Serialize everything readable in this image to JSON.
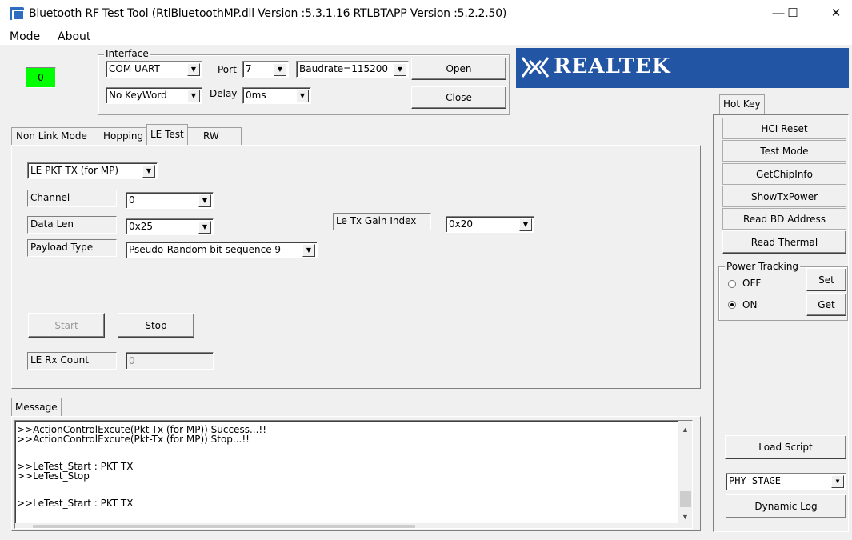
{
  "window": {
    "title": "Bluetooth RF Test Tool (RtlBluetoothMP.dll Version :5.3.1.16   RTLBTAPP Version :5.2.2.50)",
    "minimize": "—",
    "maximize": "☐",
    "close": "✕"
  },
  "menu": {
    "mode": "Mode",
    "about": "About"
  },
  "status_indicator": {
    "value": "0",
    "color": "#00ff00"
  },
  "interface": {
    "group_label": "Interface",
    "connection": "COM UART",
    "port_label": "Port",
    "port": "7",
    "baudrate": "Baudrate=115200",
    "keyword": "No KeyWord",
    "delay_label": "Delay",
    "delay": "0ms",
    "open": "Open",
    "close": "Close"
  },
  "logo": {
    "text": "REALTEK",
    "color": "#2255a4"
  },
  "tabs": {
    "non_link_mode": "Non Link Mode",
    "hopping": "Hopping",
    "le_test": "LE Test",
    "rw": "RW",
    "active": "LE Test"
  },
  "le_test": {
    "mode": "LE PKT TX (for MP)",
    "channel_label": "Channel",
    "channel": "0",
    "data_len_label": "Data Len",
    "data_len": "0x25",
    "payload_label": "Payload Type",
    "payload": "Pseudo-Random bit sequence 9",
    "gain_label": "Le Tx Gain Index",
    "gain": "0x20",
    "start": "Start",
    "stop": "Stop",
    "rx_count_label": "LE Rx Count",
    "rx_count": "0"
  },
  "message": {
    "tab": "Message",
    "lines": [
      ">>ActionControlExcute(Pkt-Tx (for MP)) Success...!!",
      ">>ActionControlExcute(Pkt-Tx (for MP)) Stop...!!",
      "",
      ">>LeTest_Start : PKT TX",
      ">>LeTest_Stop",
      "",
      ">>LeTest_Start : PKT TX"
    ]
  },
  "hotkey": {
    "tab": "Hot Key",
    "hci_reset": "HCI Reset",
    "test_mode": "Test Mode",
    "get_chip_info": "GetChipInfo",
    "show_tx_power": "ShowTxPower",
    "read_bd_address": "Read BD Address",
    "read_thermal": "Read Thermal",
    "power_tracking_label": "Power Tracking",
    "off": "OFF",
    "on": "ON",
    "selected": "ON",
    "set": "Set",
    "get": "Get",
    "load_script": "Load Script",
    "stage": "PHY_STAGE",
    "dynamic_log": "Dynamic Log"
  }
}
